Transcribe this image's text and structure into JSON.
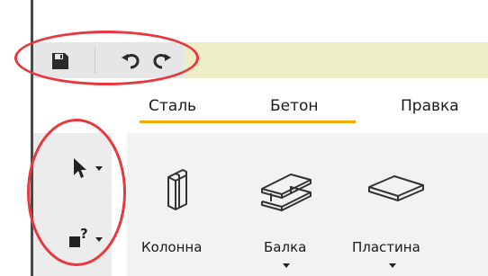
{
  "quick_access": {
    "save_icon": "save-icon",
    "undo_icon": "undo-icon",
    "redo_icon": "redo-icon"
  },
  "ribbon": {
    "tabs": [
      {
        "label": "Сталь",
        "active": true
      },
      {
        "label": "Бетон",
        "active": true
      },
      {
        "label": "Правка",
        "active": false
      }
    ],
    "accent_color": "#f2a900",
    "tools": [
      {
        "label": "Колонна",
        "icon": "column-icon",
        "has_dropdown": false
      },
      {
        "label": "Балка",
        "icon": "beam-icon",
        "has_dropdown": true
      },
      {
        "label": "Пластина",
        "icon": "plate-icon",
        "has_dropdown": true
      }
    ]
  },
  "left_tools": [
    {
      "icon": "pointer-arrow-icon",
      "has_dropdown": true
    },
    {
      "icon": "query-help-icon",
      "has_dropdown": true
    }
  ],
  "annotation_color": "#e8373d"
}
